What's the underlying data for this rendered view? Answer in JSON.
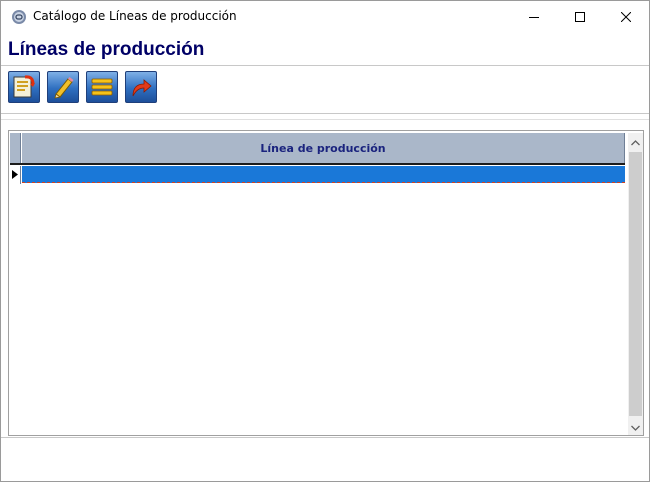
{
  "window": {
    "title": "Catálogo de Líneas de producción",
    "app_icon": "link-gear-icon",
    "controls": [
      "minimize-icon",
      "maximize-icon",
      "close-icon"
    ]
  },
  "form": {
    "heading": "Líneas de producción"
  },
  "toolbar": {
    "buttons": [
      {
        "name": "new-record-button",
        "icon": "new-document-icon"
      },
      {
        "name": "edit-button",
        "icon": "pencil-icon"
      },
      {
        "name": "list-button",
        "icon": "list-icon"
      },
      {
        "name": "exit-button",
        "icon": "return-arrow-icon"
      }
    ]
  },
  "grid": {
    "columns": [
      "Línea de producción"
    ],
    "rows": [
      ""
    ],
    "selected_row": 0
  },
  "colors": {
    "heading": "#000066",
    "header_bg": "#aab7c9",
    "header_text": "#1a237e",
    "selection": "#1a78d8",
    "toolbar_button": "#2f6fc0"
  }
}
